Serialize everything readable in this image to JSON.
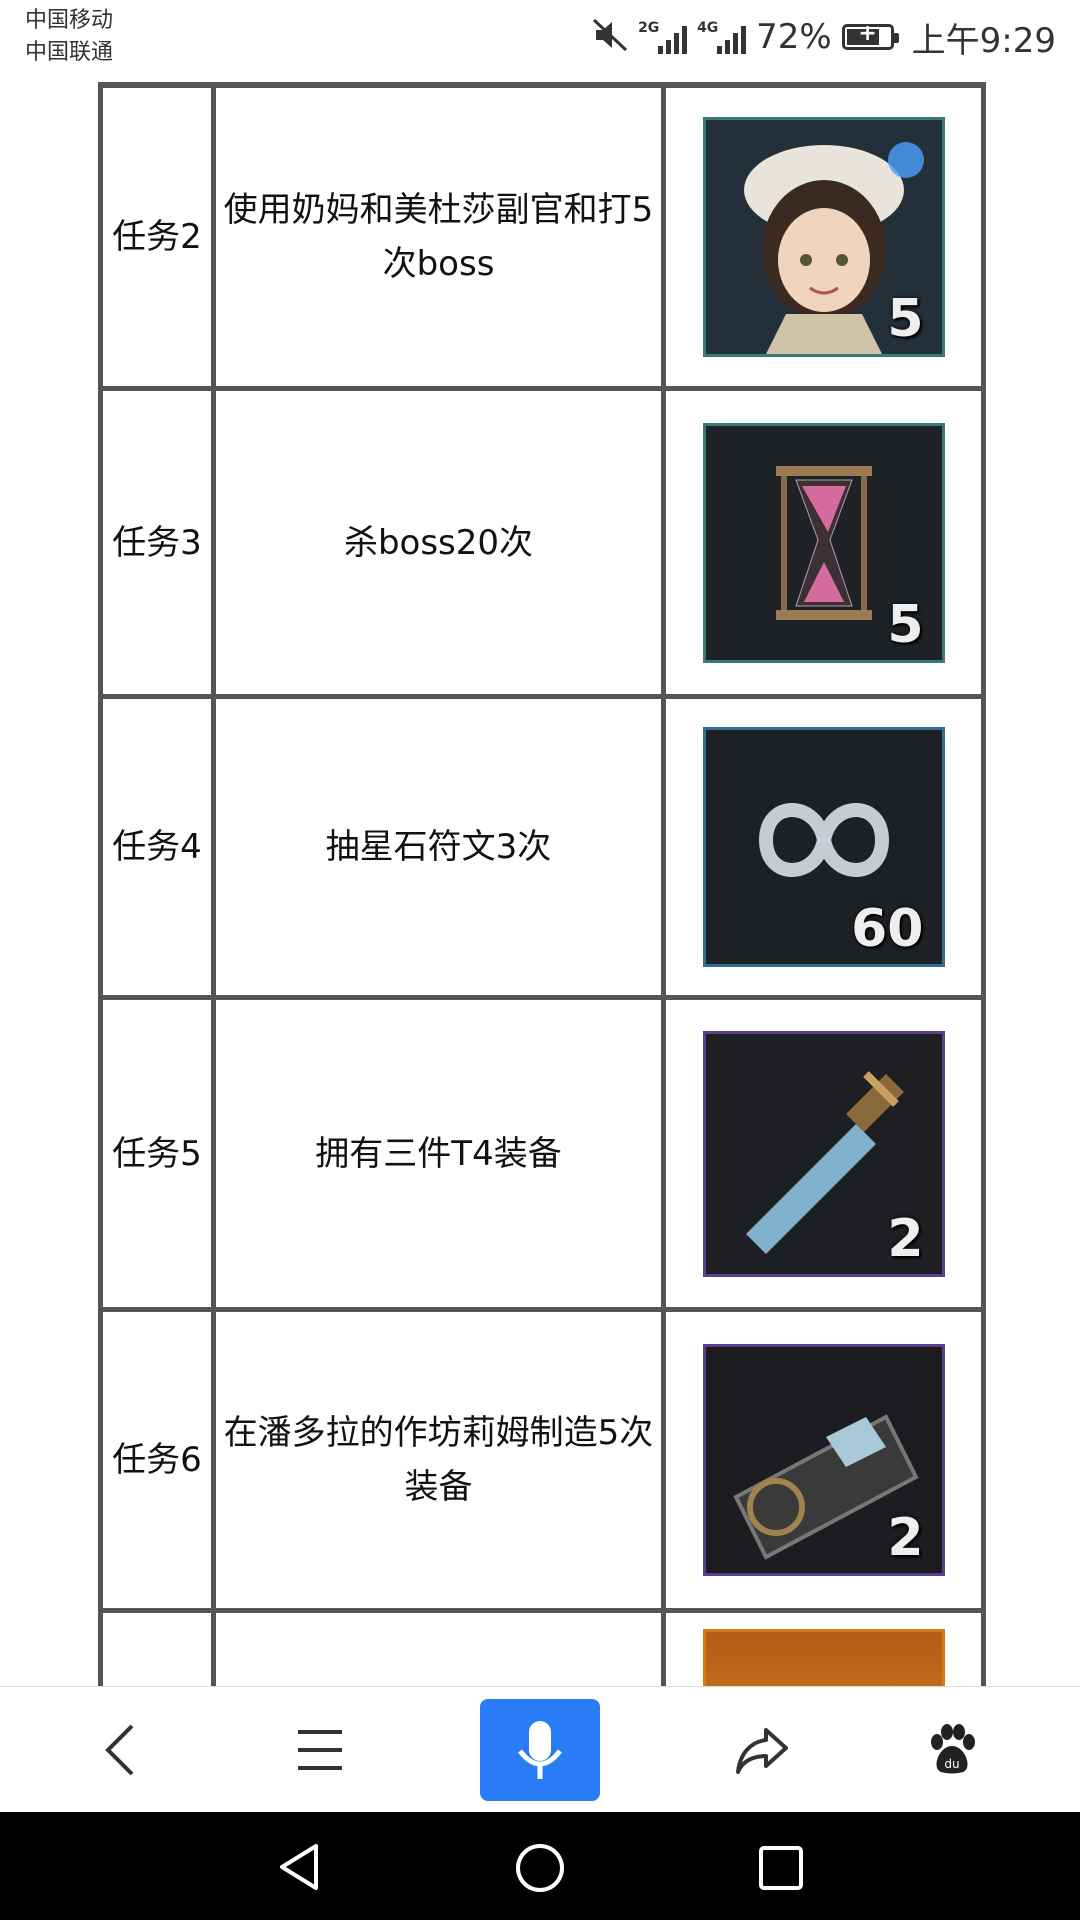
{
  "status_bar": {
    "carrier_1": "中国移动",
    "carrier_2": "中国联通",
    "net_1": "2G",
    "net_2": "4G",
    "battery": "72%",
    "time": "上午9:29"
  },
  "tasks": [
    {
      "id": "任务2",
      "desc": "使用奶妈和美杜莎副官和打5次boss",
      "reward_icon": "healer-portrait-icon",
      "count": "5",
      "frame": "#3f8f87"
    },
    {
      "id": "任务3",
      "desc": "杀boss20次",
      "reward_icon": "hourglass-icon",
      "count": "5",
      "frame": "#3f8f87"
    },
    {
      "id": "任务4",
      "desc": "抽星石符文3次",
      "reward_icon": "infinity-rune-icon",
      "count": "60",
      "frame": "#2f6f8f"
    },
    {
      "id": "任务5",
      "desc": "拥有三件T4装备",
      "reward_icon": "dagger-icon",
      "count": "2",
      "frame": "#5a3f8f"
    },
    {
      "id": "任务6",
      "desc": "在潘多拉的作坊莉姆制造5次装备",
      "reward_icon": "blueprint-icon",
      "count": "2",
      "frame": "#5a3f8f"
    },
    {
      "id": "",
      "desc": "",
      "reward_icon": "orange-item-icon",
      "count": "",
      "frame": "#d17a16"
    }
  ],
  "toolbar": {
    "icons": [
      "back-icon",
      "menu-icon",
      "microphone-icon",
      "share-icon",
      "baidu-paw-icon"
    ]
  },
  "navbar": {
    "icons": [
      "nav-back-icon",
      "nav-home-icon",
      "nav-recents-icon"
    ]
  },
  "colors": {
    "mic_button": "#2a7cf6",
    "table_border": "#555555"
  }
}
